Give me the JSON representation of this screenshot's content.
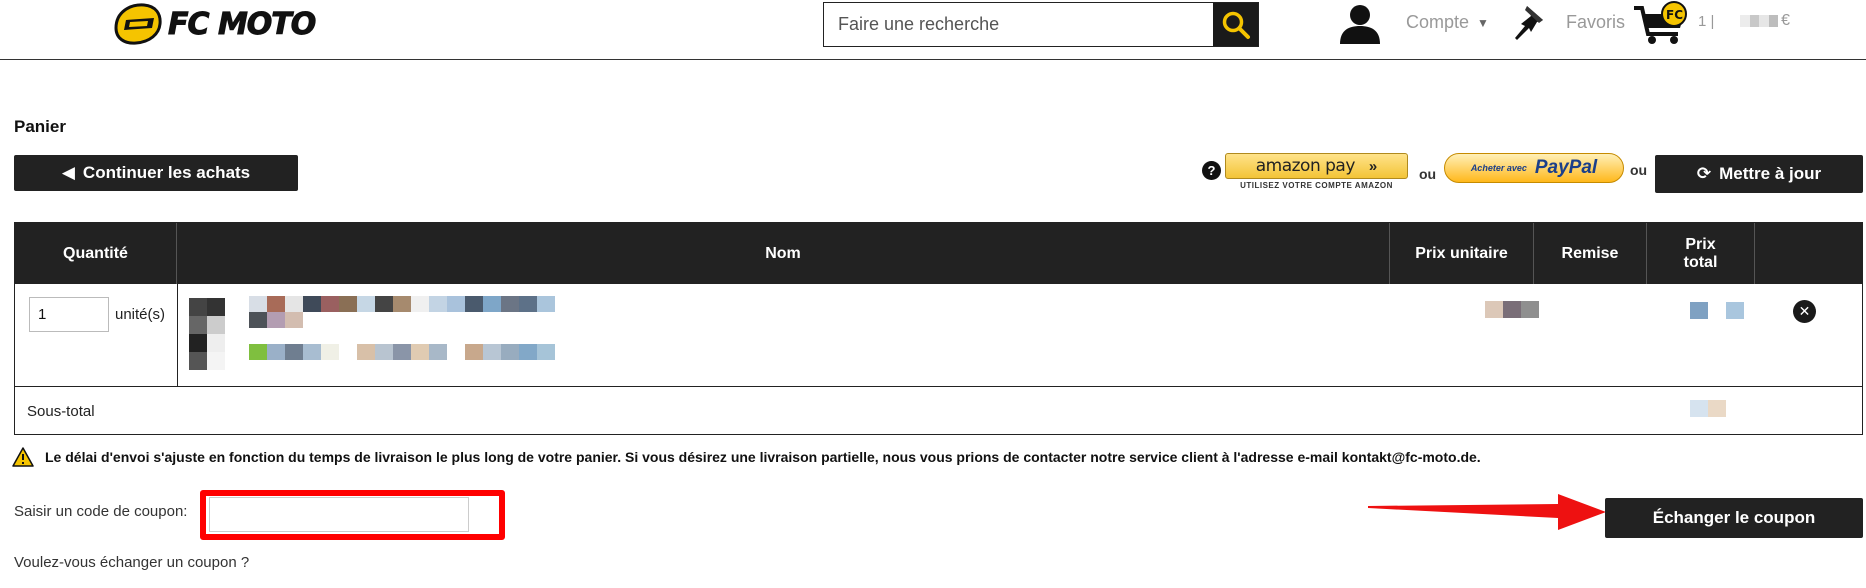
{
  "header": {
    "logo_text": "FC MOTO",
    "search_placeholder": "Faire une recherche",
    "account_label": "Compte",
    "favorites_label": "Favoris",
    "cart_count": "1 |",
    "cart_currency": "€"
  },
  "page": {
    "title": "Panier",
    "continue_label": "Continuer les achats",
    "update_label": "Mettre à jour",
    "or_label": "ou",
    "amazon_pay_label": "amazon pay",
    "amazon_pay_sub": "UTILISEZ VOTRE COMPTE AMAZON",
    "paypal_small": "Acheter avec",
    "paypal_label": "PayPal"
  },
  "table": {
    "headers": [
      "Quantité",
      "Nom",
      "Prix unitaire",
      "Remise",
      "Prix total",
      ""
    ],
    "rows": [
      {
        "quantity": "1",
        "unit_label": "unité(s)"
      }
    ],
    "subtotal_label": "Sous-total"
  },
  "notice": "Le délai d'envoi s'ajuste en fonction du temps de livraison le plus long de votre panier. Si vous désirez une livraison partielle, nous vous prions de contacter notre service client à l'adresse e-mail kontakt@fc-moto.de.",
  "coupon": {
    "label": "Saisir un code de coupon:",
    "value": "",
    "button_label": "Échanger le coupon",
    "link_label": "Voulez-vous échanger un coupon ?"
  },
  "colors": {
    "dark": "#222222",
    "accent_yellow": "#f5c400",
    "highlight_red": "#ff0000"
  },
  "icons": [
    "fc-moto-helmet-icon",
    "search-icon",
    "account-icon",
    "pin-icon",
    "cart-icon",
    "help-icon",
    "remove-icon",
    "warning-icon",
    "arrow-icon",
    "refresh-icon",
    "left-triangle-icon"
  ]
}
